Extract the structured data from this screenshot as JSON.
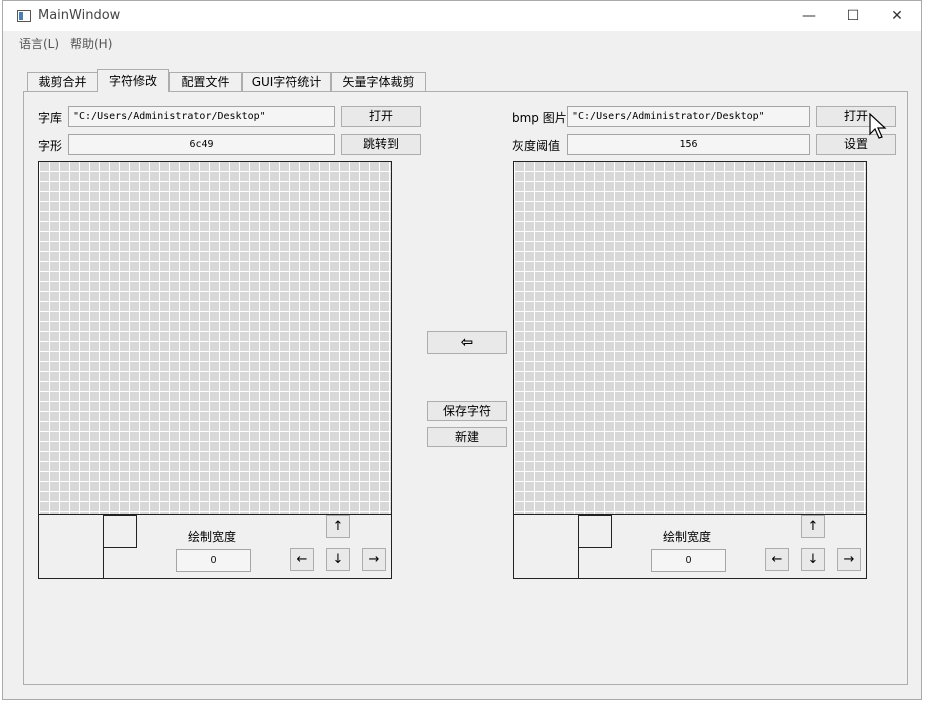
{
  "window": {
    "title": "MainWindow",
    "minimize": "—",
    "maximize": "☐",
    "close": "✕"
  },
  "menu": {
    "language": "语言(L)",
    "help": "帮助(H)"
  },
  "tabs": [
    "裁剪合并",
    "字符修改",
    "配置文件",
    "GUI字符统计",
    "矢量字体裁剪"
  ],
  "active_tab": 1,
  "left": {
    "font_label": "字库",
    "font_path": "\"C:/Users/Administrator/Desktop\"",
    "open_button": "打开",
    "glyph_label": "字形",
    "glyph_value": "6c49",
    "jump_button": "跳转到",
    "draw_width_label": "绘制宽度",
    "draw_width_value": "0"
  },
  "right": {
    "bmp_label": "bmp 图片",
    "bmp_path": "\"C:/Users/Administrator/Desktop\"",
    "open_button": "打开",
    "threshold_label": "灰度阈值",
    "threshold_value": "156",
    "set_button": "设置",
    "draw_width_label": "绘制宽度",
    "draw_width_value": "0"
  },
  "center": {
    "copy_left_icon": "arrow-left-icon",
    "copy_left_glyph": "⇦",
    "save_char_button": "保存字符",
    "new_button": "新建"
  },
  "arrows": {
    "up": "↑",
    "down": "↓",
    "left": "←",
    "right": "→"
  }
}
